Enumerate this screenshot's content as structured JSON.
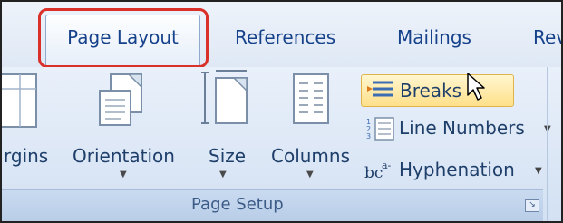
{
  "tabs": [
    {
      "label": "Page Layout",
      "active": true
    },
    {
      "label": "References"
    },
    {
      "label": "Mailings"
    },
    {
      "label": "Rev"
    }
  ],
  "ribbon": {
    "group_label": "Page Setup",
    "big_buttons": {
      "margins": "rgins",
      "orientation": "Orientation",
      "size": "Size",
      "columns": "Columns"
    },
    "small_buttons": {
      "breaks": "Breaks",
      "line_numbers": "Line Numbers",
      "hyphenation": "Hyphenation"
    },
    "hyphenation_icon_text": "bc a-"
  },
  "colors": {
    "highlight": "#d9302a",
    "hover": "#ffe08a",
    "text": "#15428b"
  }
}
